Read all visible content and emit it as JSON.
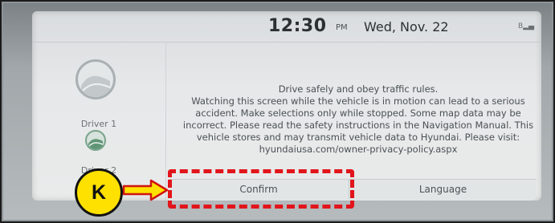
{
  "clock": {
    "time": "12:30",
    "ampm": "PM",
    "date": "Wed, Nov. 22"
  },
  "status": {
    "signal": "B"
  },
  "drivers": [
    {
      "label": "Driver 1"
    },
    {
      "label": "Driver 2"
    }
  ],
  "message": {
    "lines": [
      "Drive safely and obey traffic rules.",
      "Watching this screen while the vehicle is in motion can lead to a serious",
      "accident. Make selections only while stopped. Some map data may be",
      "incorrect. Please read the safety instructions in the Navigation Manual. This",
      "vehicle stores and may transmit vehicle data to Hyundai. Please visit:",
      "hyundaiusa.com/owner-privacy-policy.aspx"
    ]
  },
  "buttons": {
    "confirm": "Confirm",
    "language": "Language"
  },
  "callout": {
    "label": "K"
  },
  "colors": {
    "highlight": "#e1151b",
    "callout_fill": "#ffe100"
  }
}
